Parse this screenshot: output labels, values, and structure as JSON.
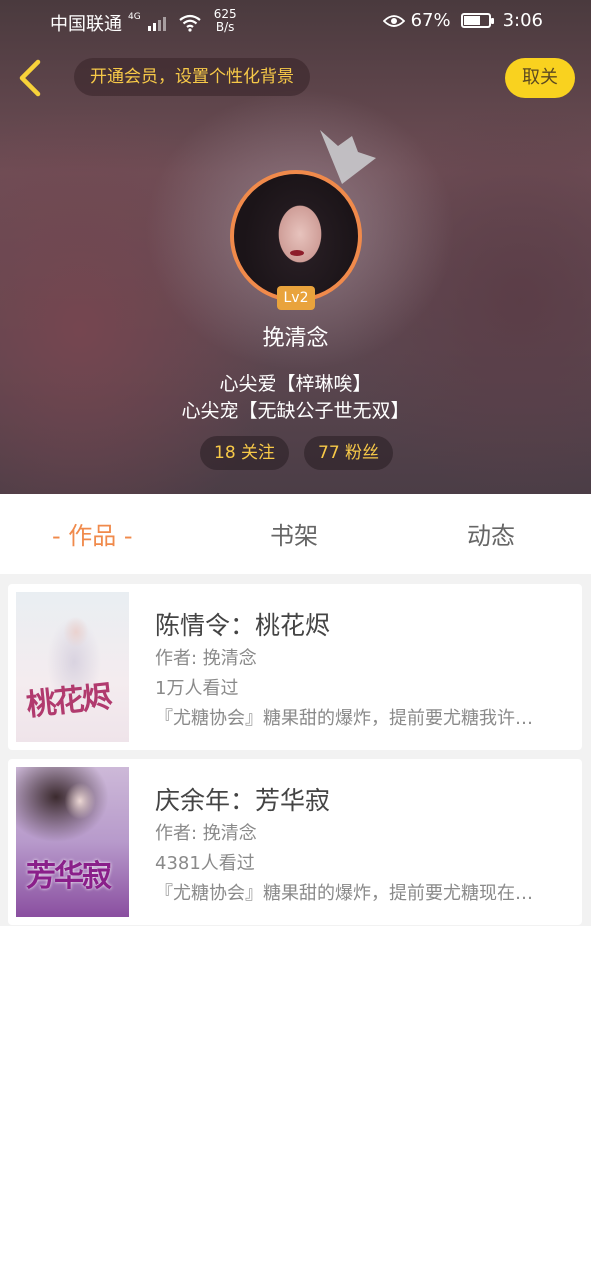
{
  "status_bar": {
    "carrier": "中国联通",
    "network": "4G",
    "speed_value": "625",
    "speed_unit": "B/s",
    "battery": "67%",
    "time": "3:06"
  },
  "header": {
    "vip_prompt": "开通会员，设置个性化背景",
    "unfollow_label": "取关",
    "level_badge": "Lv2",
    "nickname": "挽清念",
    "bio_line1": "心尖爱【梓琳唉】",
    "bio_line2": "心尖宠【无缺公子世无双】",
    "following": "18 关注",
    "fans": "77 粉丝"
  },
  "tabs": {
    "works": "- 作品 -",
    "bookshelf": "书架",
    "activity": "动态"
  },
  "books": [
    {
      "title": "陈情令：桃花烬",
      "author": "作者: 挽清念",
      "views": "1万人看过",
      "desc": "『尤糖协会』糖果甜的爆炸，提前要尤糖我许…",
      "cover_text": "桃花烬"
    },
    {
      "title": "庆余年：芳华寂",
      "author": "作者: 挽清念",
      "views": "4381人看过",
      "desc": "『尤糖协会』糖果甜的爆炸，提前要尤糖现在…",
      "cover_text": "芳华寂"
    }
  ],
  "colors": {
    "accent": "#f08a4b",
    "vip_yellow": "#f7c948",
    "button_yellow": "#f9d21f"
  }
}
